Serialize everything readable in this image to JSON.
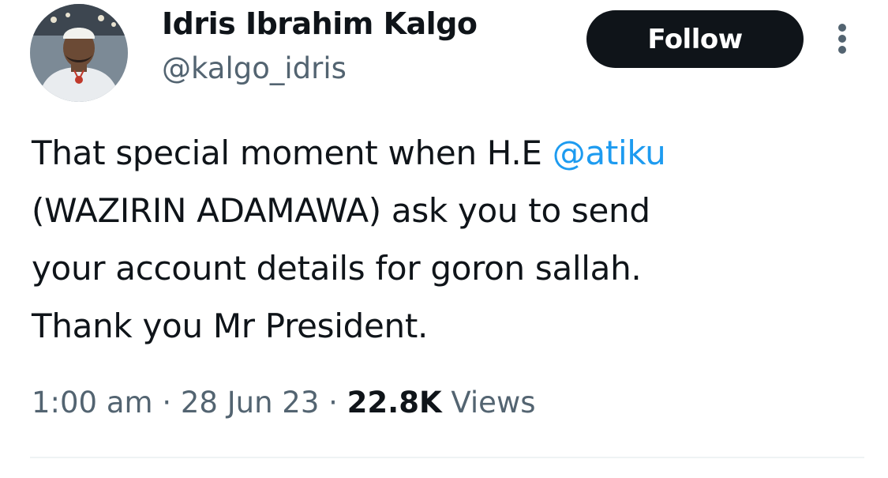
{
  "author": {
    "display_name": "Idris Ibrahim Kalgo",
    "handle": "@kalgo_idris",
    "avatar_icon": "profile-photo"
  },
  "actions": {
    "follow_label": "Follow",
    "more_icon": "vertical-ellipsis-icon"
  },
  "tweet": {
    "lines": [
      {
        "before": "That special moment when H.E ",
        "mention": "@atiku"
      },
      {
        "text": "(WAZIRIN ADAMAWA) ask you to send"
      },
      {
        "text": "your account details for goron sallah."
      },
      {
        "text": "Thank you Mr President."
      }
    ]
  },
  "meta": {
    "time": "1:00 am",
    "separator": " · ",
    "date": "28 Jun 23",
    "views_count": "22.8K",
    "views_label": " Views"
  },
  "colors": {
    "text": "#0f1419",
    "secondary": "#536471",
    "link": "#1d9bf0",
    "button_bg": "#0f1419",
    "divider": "#eff3f4"
  }
}
